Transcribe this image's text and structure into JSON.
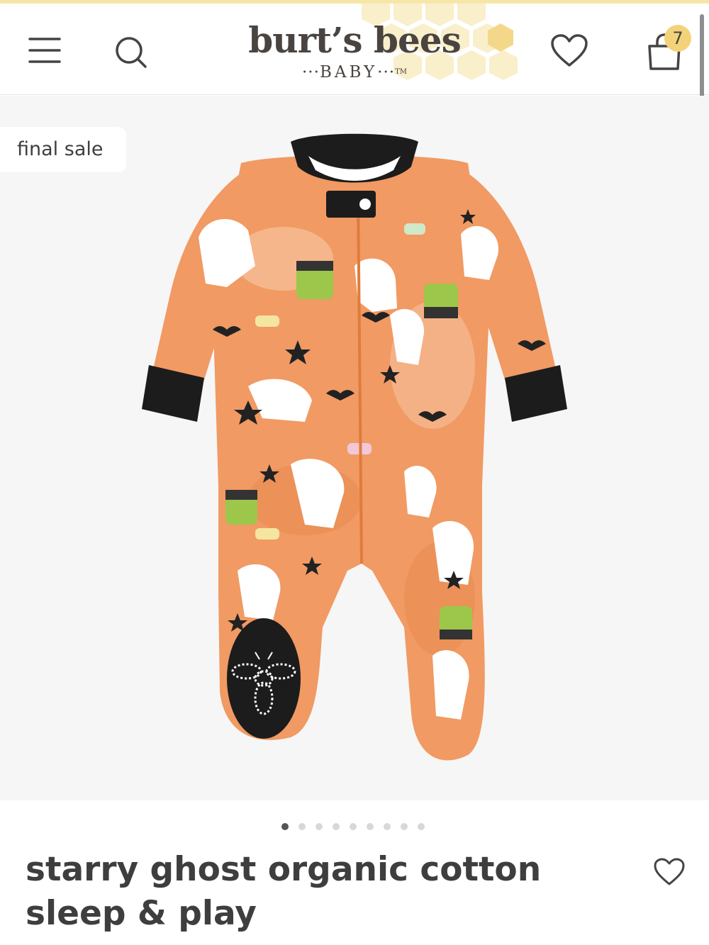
{
  "header": {
    "logo_main": "burt’s bees",
    "logo_sub": "BABY",
    "logo_tm": "TM",
    "cart_count": "7",
    "icons": [
      "menu-icon",
      "search-icon",
      "heart-icon",
      "shopping-bag-icon"
    ]
  },
  "gallery": {
    "badge": "final sale",
    "slide_count": 9,
    "active_slide": 1
  },
  "product": {
    "title": "starry ghost organic cotton sleep & play"
  },
  "colors": {
    "accent_yellow": "#f4d27a",
    "text_dark": "#3e3e3e",
    "gallery_bg": "#f6f6f6",
    "pajama_orange": "#f19a63",
    "pajama_trim": "#1c1c1c"
  }
}
